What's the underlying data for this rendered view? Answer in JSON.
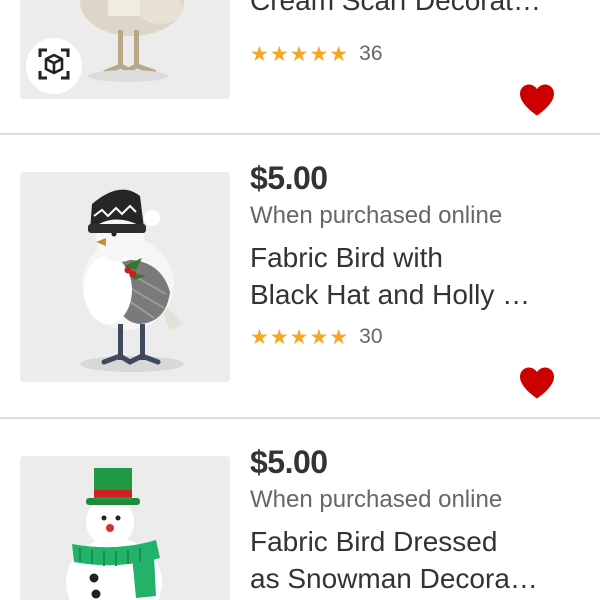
{
  "colors": {
    "accent_heart": "#cc0000",
    "star": "#f5a623",
    "divider": "#dcdcdc"
  },
  "products": [
    {
      "price": "",
      "subtext": "",
      "title_lines": [
        "",
        "Cream Scarf Decorat…"
      ],
      "stars": "★★★★★",
      "review_count": "36",
      "has_ar_badge": true,
      "ar_icon": "augmented-reality-cube-icon",
      "favorite_icon": "heart-icon"
    },
    {
      "price": "$5.00",
      "subtext": "When purchased online",
      "title_lines": [
        "Fabric Bird with",
        "Black Hat and Holly …"
      ],
      "stars": "★★★★★",
      "review_count": "30",
      "favorite_icon": "heart-icon"
    },
    {
      "price": "$5.00",
      "subtext": "When purchased online",
      "title_lines": [
        "Fabric Bird Dressed",
        "as Snowman Decora…"
      ],
      "favorite_icon": "heart-icon"
    }
  ]
}
